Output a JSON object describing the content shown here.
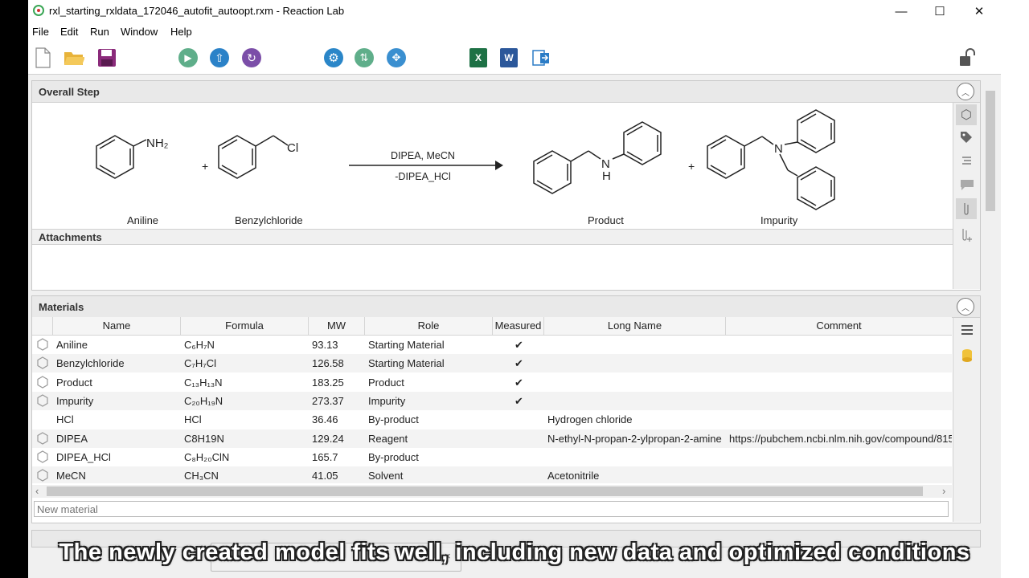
{
  "window": {
    "title": "rxl_starting_rxldata_172046_autofit_autoopt.rxm - Reaction Lab",
    "minimize": "—",
    "maximize": "☐",
    "close": "✕"
  },
  "menu": [
    "File",
    "Edit",
    "Run",
    "Window",
    "Help"
  ],
  "toolbar": {
    "icons": [
      "new-file-icon",
      "open-folder-icon",
      "save-icon",
      "run-icon",
      "upload-icon",
      "refresh-icon",
      "settings-icon",
      "fit-icon",
      "optimize-icon",
      "excel-icon",
      "word-icon",
      "export-icon",
      "lock-icon"
    ],
    "excel_letter": "X",
    "word_letter": "W"
  },
  "overall_step": {
    "title": "Overall Step",
    "collapse": "︿",
    "reagents_label": "DIPEA, MeCN",
    "byproduct_label": "-DIPEA_HCl",
    "plus": "+",
    "molecules": [
      "Aniline",
      "Benzylchloride",
      "Product",
      "Impurity"
    ],
    "atom_labels": {
      "nh2": "NH₂",
      "cl": "Cl",
      "n_h": "N",
      "h": "H",
      "n": "N"
    },
    "attachments_title": "Attachments",
    "side_icons": [
      "structure-icon",
      "tag-icon",
      "list-icon",
      "comment-icon",
      "attachment-icon",
      "add-attachment-icon"
    ]
  },
  "materials": {
    "title": "Materials",
    "collapse": "︿",
    "columns": [
      "Name",
      "Formula",
      "MW",
      "Role",
      "Measured",
      "Long Name",
      "Comment"
    ],
    "rows": [
      {
        "name": "Aniline",
        "formula": "C₆H₇N",
        "mw": "93.13",
        "role": "Starting Material",
        "measured": "✔",
        "long_name": "",
        "comment": "",
        "icon": true
      },
      {
        "name": "Benzylchloride",
        "formula": "C₇H₇Cl",
        "mw": "126.58",
        "role": "Starting Material",
        "measured": "✔",
        "long_name": "",
        "comment": "",
        "icon": true
      },
      {
        "name": "Product",
        "formula": "C₁₃H₁₃N",
        "mw": "183.25",
        "role": "Product",
        "measured": "✔",
        "long_name": "",
        "comment": "",
        "icon": true
      },
      {
        "name": "Impurity",
        "formula": "C₂₀H₁₉N",
        "mw": "273.37",
        "role": "Impurity",
        "measured": "✔",
        "long_name": "",
        "comment": "",
        "icon": true
      },
      {
        "name": "HCl",
        "formula": "HCl",
        "mw": "36.46",
        "role": "By-product",
        "measured": "",
        "long_name": "Hydrogen chloride",
        "comment": "",
        "icon": false
      },
      {
        "name": "DIPEA",
        "formula": "C8H19N",
        "mw": "129.24",
        "role": "Reagent",
        "measured": "",
        "long_name": "N-ethyl-N-propan-2-ylpropan-2-amine",
        "comment": "https://pubchem.ncbi.nlm.nih.gov/compound/815",
        "icon": true
      },
      {
        "name": "DIPEA_HCl",
        "formula": "C₈H₂₀ClN",
        "mw": "165.7",
        "role": "By-product",
        "measured": "",
        "long_name": "",
        "comment": "",
        "icon": true
      },
      {
        "name": "MeCN",
        "formula": "CH₃CN",
        "mw": "41.05",
        "role": "Solvent",
        "measured": "",
        "long_name": "Acetonitrile",
        "comment": "",
        "icon": true
      }
    ],
    "new_material_placeholder": "New material",
    "scroll_left": "‹",
    "scroll_right": "›",
    "side_icons": [
      "menu-icon",
      "database-icon"
    ]
  },
  "caption": "The newly created model fits well, including new data and optimized conditions",
  "tooltip_close": "×"
}
